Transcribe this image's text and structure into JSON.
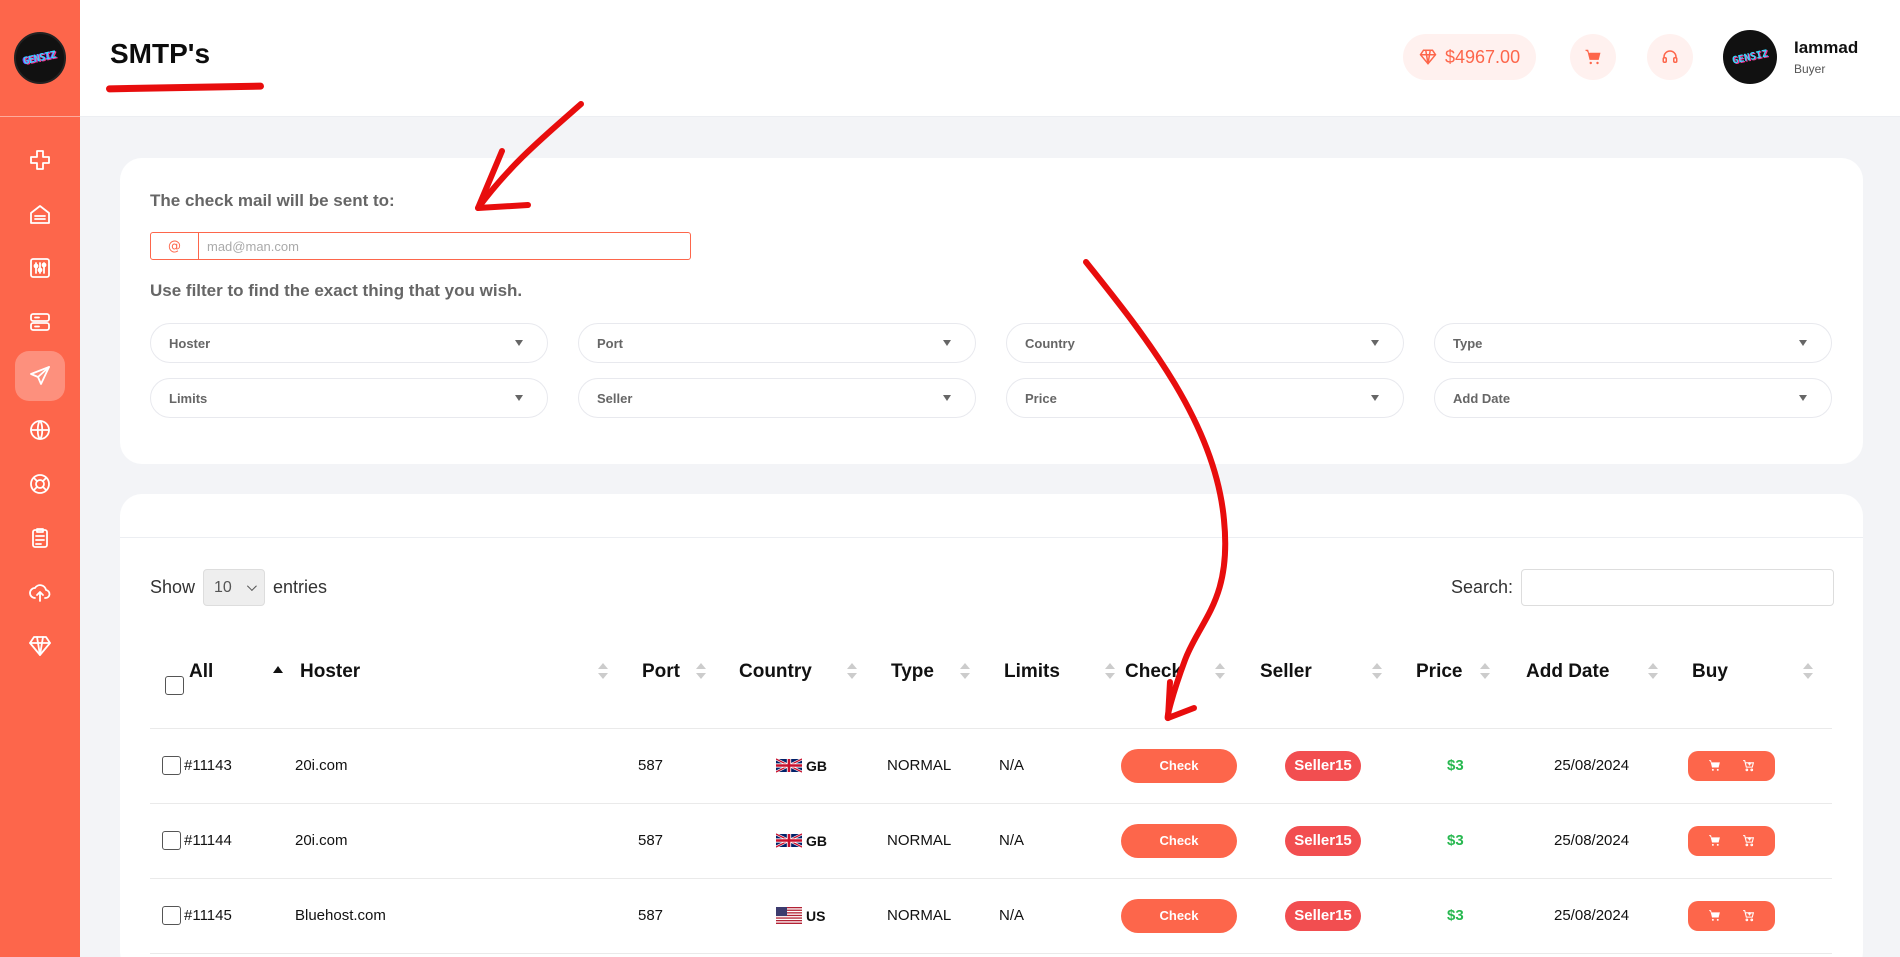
{
  "app": {
    "logo_text": "GENSIZ"
  },
  "sidebar": {
    "items": [
      {
        "name": "add",
        "icon": "plus-icon",
        "active": false
      },
      {
        "name": "home",
        "icon": "home-icon",
        "active": false
      },
      {
        "name": "tools",
        "icon": "sliders-icon",
        "active": false
      },
      {
        "name": "servers",
        "icon": "server-icon",
        "active": false
      },
      {
        "name": "smtp",
        "icon": "send-icon",
        "active": true
      },
      {
        "name": "web",
        "icon": "globe-icon",
        "active": false
      },
      {
        "name": "support",
        "icon": "lifebuoy-icon",
        "active": false
      },
      {
        "name": "orders",
        "icon": "clipboard-icon",
        "active": false
      },
      {
        "name": "cloud",
        "icon": "cloud-upload-icon",
        "active": false
      },
      {
        "name": "premium",
        "icon": "diamond-icon",
        "active": false
      }
    ]
  },
  "header": {
    "title": "SMTP's",
    "balance": "$4967.00",
    "user": {
      "name": "Iammad",
      "role": "Buyer"
    }
  },
  "filter": {
    "mail_label": "The check mail will be sent to:",
    "mail_prefix": "@",
    "mail_placeholder": "mad@man.com",
    "filter_label": "Use filter to find the exact thing that you wish.",
    "selects": [
      "Hoster",
      "Port",
      "Country",
      "Type",
      "Limits",
      "Seller",
      "Price",
      "Add Date"
    ]
  },
  "table": {
    "show_label": "Show",
    "entries_value": "10",
    "entries_label": "entries",
    "search_label": "Search:",
    "headers": [
      "All",
      "Hoster",
      "Port",
      "Country",
      "Type",
      "Limits",
      "Check",
      "Seller",
      "Price",
      "Add Date",
      "Buy"
    ],
    "rows": [
      {
        "id": "#11143",
        "hoster": "20i.com",
        "port": "587",
        "country": "GB",
        "type": "NORMAL",
        "limits": "N/A",
        "check": "Check",
        "seller": "Seller15",
        "price": "$3",
        "date": "25/08/2024"
      },
      {
        "id": "#11144",
        "hoster": "20i.com",
        "port": "587",
        "country": "GB",
        "type": "NORMAL",
        "limits": "N/A",
        "check": "Check",
        "seller": "Seller15",
        "price": "$3",
        "date": "25/08/2024"
      },
      {
        "id": "#11145",
        "hoster": "Bluehost.com",
        "port": "587",
        "country": "US",
        "type": "NORMAL",
        "limits": "N/A",
        "check": "Check",
        "seller": "Seller15",
        "price": "$3",
        "date": "25/08/2024"
      }
    ]
  },
  "colors": {
    "accent": "#fd664b",
    "seller": "#f24e50",
    "price": "#28b850",
    "annotation": "#e80d0d"
  }
}
